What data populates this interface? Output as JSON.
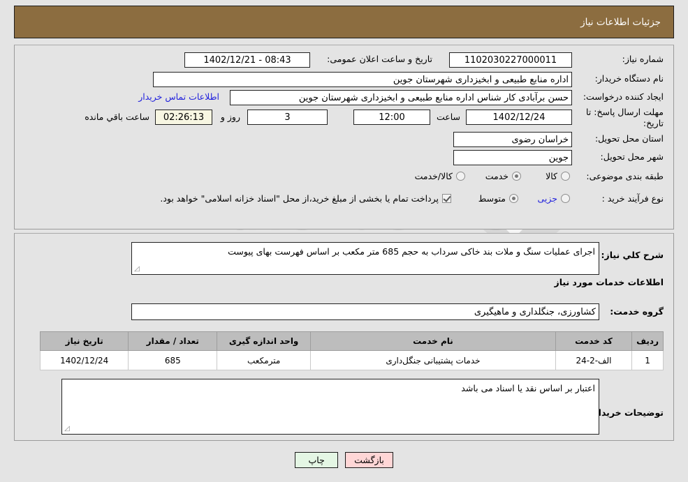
{
  "header": {
    "title": "جزئیات اطلاعات نیاز"
  },
  "watermark": {
    "text": "AriaTender.net"
  },
  "form": {
    "need_number_label": "شماره نیاز:",
    "need_number_value": "1102030227000011",
    "announce_datetime_label": "تاریخ و ساعت اعلان عمومی:",
    "announce_datetime_value": "08:43 - 1402/12/21",
    "buyer_org_label": "نام دستگاه خریدار:",
    "buyer_org_value": "اداره منابع طبیعی و ابخیزداری شهرستان جوین",
    "creator_label": "ایجاد کننده درخواست:",
    "creator_value": "حسن برآبادی کار شناس اداره منابع طبیعی و ابخیزداری شهرستان جوین",
    "contact_link": "اطلاعات تماس خریدار",
    "deadline_label": "مهلت ارسال پاسخ: تا تاریخ:",
    "deadline_date": "1402/12/24",
    "hour_label": "ساعت",
    "hour_value": "12:00",
    "days_value": "3",
    "days_and_label": "روز و",
    "timer_value": "02:26:13",
    "remaining_label": "ساعت باقي مانده",
    "province_label": "استان محل تحویل:",
    "province_value": "خراسان رضوی",
    "city_label": "شهر محل تحویل:",
    "city_value": "جوین",
    "category_label": "طبقه بندی موضوعی:",
    "category_options": [
      {
        "label": "کالا",
        "checked": false
      },
      {
        "label": "خدمت",
        "checked": true
      },
      {
        "label": "کالا/خدمت",
        "checked": false
      }
    ],
    "purchase_type_label": "نوع فرآیند خرید :",
    "purchase_options": [
      {
        "label": "جزیی",
        "checked": false
      },
      {
        "label": "متوسط",
        "checked": true
      }
    ],
    "treasury_checkbox_label": "پرداخت تمام یا بخشی از مبلغ خرید،از محل \"اسناد خزانه اسلامی\" خواهد بود.",
    "treasury_checked": true
  },
  "details": {
    "general_desc_label": "شرح کلي نیاز:",
    "general_desc_value": "اجرای عملیات سنگ و ملات بند خاکی سرداب به حجم 685 متر مکعب بر اساس فهرست بهای پیوست",
    "services_info_title": "اطلاعات خدمات مورد نیاز",
    "service_group_label": "گروه خدمت:",
    "service_group_value": "کشاورزی، جنگلداری و ماهیگیری",
    "buyer_notes_label": "توضیحات خریدار:",
    "buyer_notes_value": "اعتبار بر اساس نقد یا اسناد می باشد"
  },
  "table": {
    "headers": [
      "ردیف",
      "کد خدمت",
      "نام خدمت",
      "واحد اندازه گیری",
      "تعداد / مقدار",
      "تاریخ نیاز"
    ],
    "rows": [
      {
        "index": "1",
        "code": "الف-2-24",
        "name": "خدمات پشتیبانی جنگل‌داری",
        "unit": "مترمکعب",
        "qty": "685",
        "date": "1402/12/24"
      }
    ]
  },
  "buttons": {
    "back": "بازگشت",
    "print": "چاپ"
  },
  "colors": {
    "header_brown": "#8c6d40",
    "link_blue": "#2222dd",
    "table_header_gray": "#bdbdbd",
    "back_button": "#ffd6d6",
    "print_button": "#e4f6e4",
    "timer_bg": "#f7f6e2"
  }
}
